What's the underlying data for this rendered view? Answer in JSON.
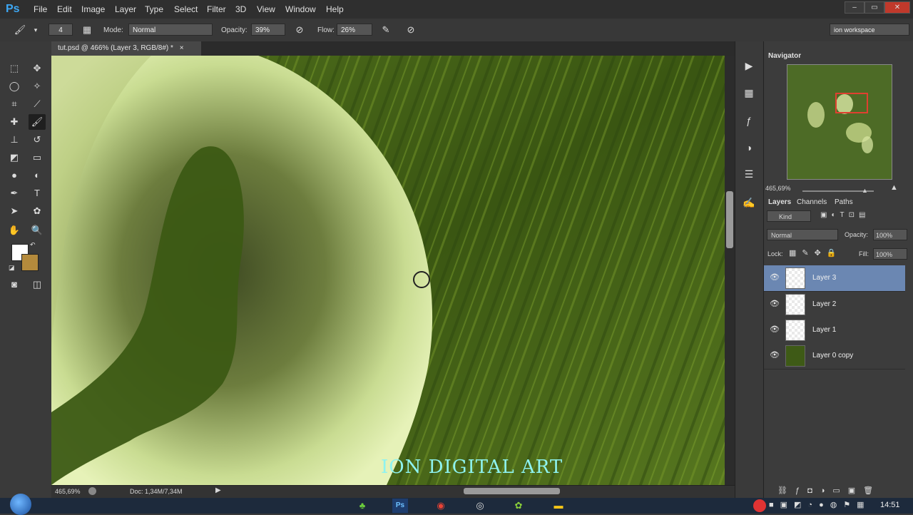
{
  "app": {
    "logo": "Ps"
  },
  "menu": [
    "File",
    "Edit",
    "Image",
    "Layer",
    "Type",
    "Select",
    "Filter",
    "3D",
    "View",
    "Window",
    "Help"
  ],
  "window_controls": {
    "minimize": "–",
    "maximize": "▭",
    "close": "✕"
  },
  "options_bar": {
    "brush_size": "4",
    "mode_label": "Mode:",
    "mode_value": "Normal",
    "opacity_label": "Opacity:",
    "opacity_value": "39%",
    "flow_label": "Flow:",
    "flow_value": "26%",
    "workspace": "ion workspace"
  },
  "document_tab": {
    "title": "tut.psd @ 466% (Layer 3, RGB/8#) *",
    "close": "×"
  },
  "canvas": {
    "watermark": "ION DIGITAL ART"
  },
  "status_bar": {
    "zoom": "465,69%",
    "doc_size": "Doc: 1,34M/7,34M"
  },
  "navigator": {
    "tab": "Navigator",
    "zoom": "465,69%"
  },
  "layers_panel": {
    "tabs": [
      "Layers",
      "Channels",
      "Paths"
    ],
    "filter_kind": "Kind",
    "blend_mode": "Normal",
    "opacity_label": "Opacity:",
    "opacity_value": "100%",
    "lock_label": "Lock:",
    "fill_label": "Fill:",
    "fill_value": "100%",
    "layers": [
      {
        "name": "Layer 3",
        "selected": true
      },
      {
        "name": "Layer 2",
        "selected": false
      },
      {
        "name": "Layer 1",
        "selected": false
      },
      {
        "name": "Layer 0 copy",
        "selected": false
      }
    ]
  },
  "colors": {
    "foreground": "#ffffff",
    "background": "#b48a3c",
    "selected_layer": "#6b87b2",
    "watermark": "#8ef3f0"
  },
  "taskbar": {
    "clock": "14:51"
  }
}
